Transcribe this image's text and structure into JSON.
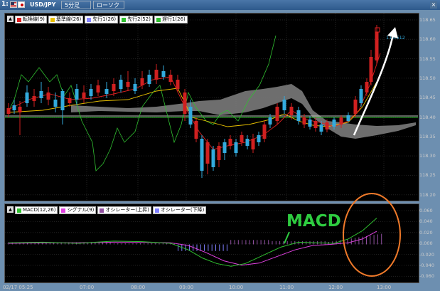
{
  "tabbar": {
    "number": "1:",
    "symbol": "USD/JPY",
    "timeframe": "5分足",
    "chart_type": "ローソク",
    "close": "×"
  },
  "main_legend": [
    {
      "label": "転換線(9)",
      "color": "#e02020"
    },
    {
      "label": "基準線(26)",
      "color": "#e8c000"
    },
    {
      "label": "先行1(26)",
      "color": "#8888ff"
    },
    {
      "label": "先行2(52)",
      "color": "#30c030"
    },
    {
      "label": "遅行1(26)",
      "color": "#30c030"
    }
  ],
  "sub_legend": [
    {
      "label": "MACD(12,26)",
      "color": "#30c030"
    },
    {
      "label": "シグナル(9)",
      "color": "#e040e0"
    },
    {
      "label": "オシレーター(上昇)",
      "color": "#9050a0"
    },
    {
      "label": "オシレーター(下降)",
      "color": "#8080ff"
    }
  ],
  "price_axis": [
    "118.65",
    "118.60",
    "118.55",
    "118.50",
    "118.45",
    "118.40",
    "118.35",
    "118.30",
    "118.25",
    "118.20"
  ],
  "macd_axis": [
    "0.060",
    "0.040",
    "0.020",
    "0.000",
    "-0.020",
    "-0.040",
    "-0.060"
  ],
  "time_axis": [
    "02/17 05:25",
    "07:00",
    "08:00",
    "09:00",
    "10:00",
    "11:00",
    "12:00",
    "13:00"
  ],
  "current_price": "118.612",
  "annotation": "MACD",
  "colors": {
    "up": "#33aadd",
    "down": "#d02020",
    "cloud": "#888888"
  }
}
